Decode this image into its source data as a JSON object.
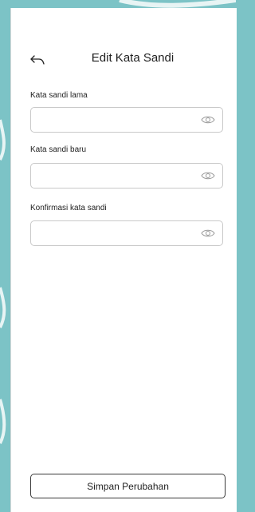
{
  "header": {
    "back_icon": "arrow-left-icon",
    "title": "Edit Kata Sandi"
  },
  "form": {
    "fields": [
      {
        "label": "Kata sandi lama",
        "value": "",
        "icon": "eye-icon"
      },
      {
        "label": "Kata sandi baru",
        "value": "",
        "icon": "eye-icon"
      },
      {
        "label": "Konfirmasi kata sandi",
        "value": "",
        "icon": "eye-icon"
      }
    ]
  },
  "actions": {
    "save_label": "Simpan Perubahan"
  },
  "colors": {
    "background": "#7cc3c6",
    "panel": "#ffffff",
    "border": "#c9c9c9"
  }
}
